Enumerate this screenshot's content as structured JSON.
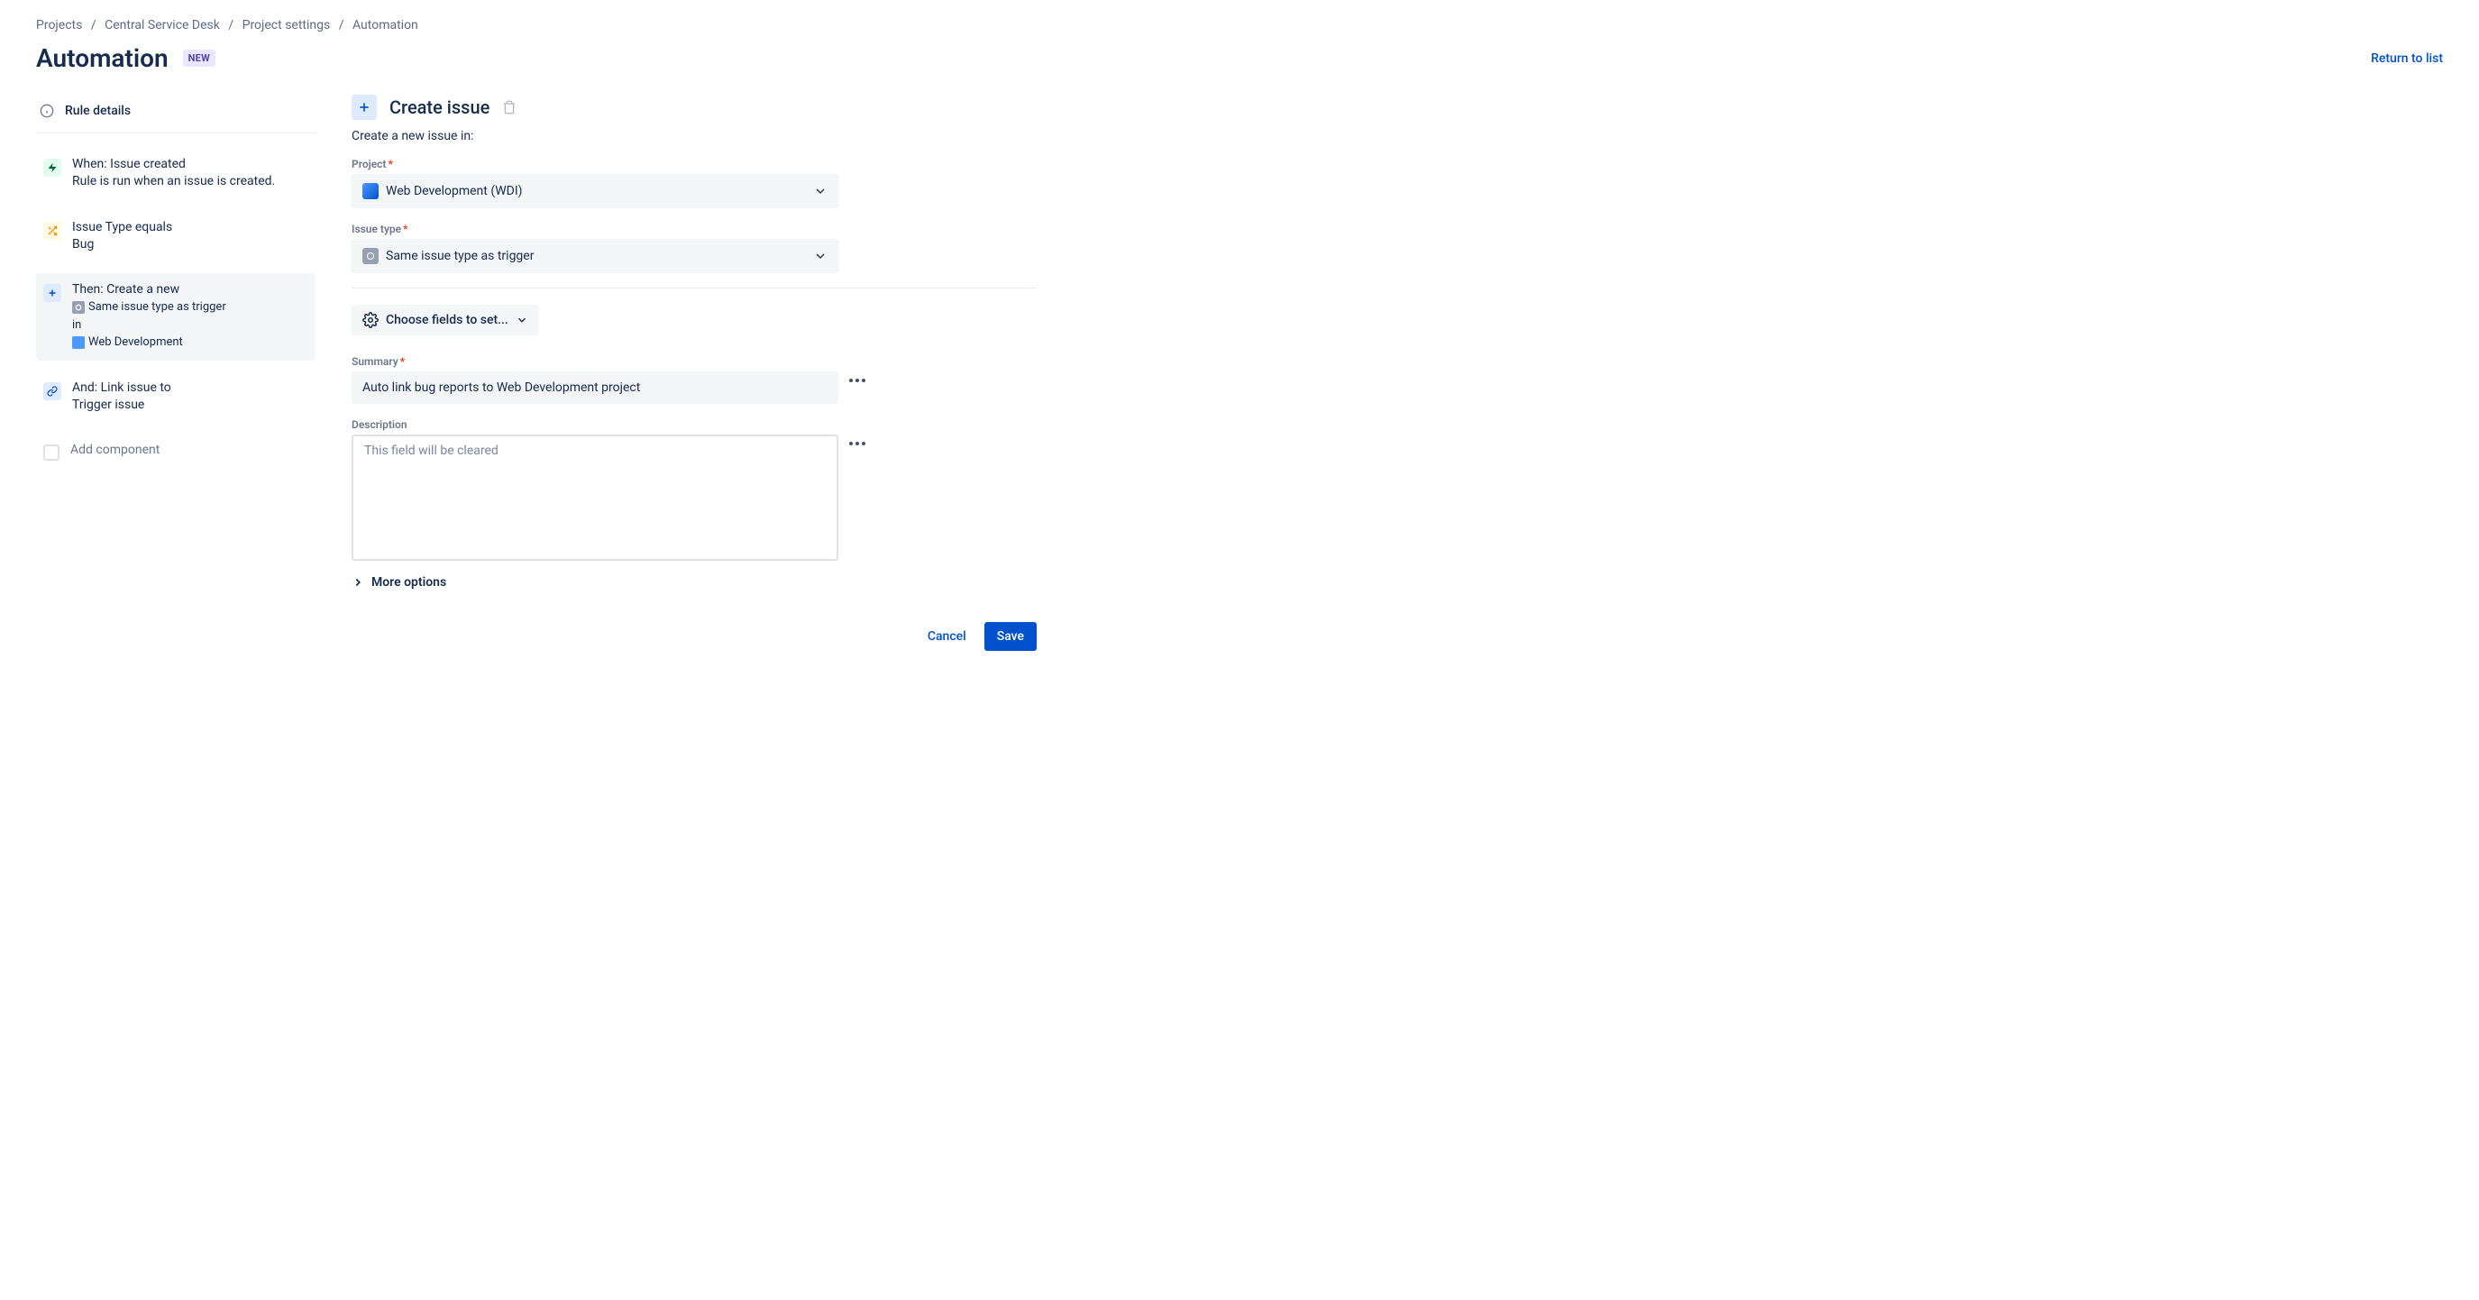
{
  "breadcrumb": {
    "items": [
      "Projects",
      "Central Service Desk",
      "Project settings",
      "Automation"
    ]
  },
  "header": {
    "title": "Automation",
    "badge": "NEW",
    "return_link": "Return to list"
  },
  "sidebar": {
    "rule_details_label": "Rule details",
    "steps": [
      {
        "title": "When: Issue created",
        "desc": "Rule is run when an issue is created."
      },
      {
        "title": "Issue Type equals",
        "desc": "Bug"
      },
      {
        "title": "Then: Create a new",
        "sub_same": "Same issue type as trigger",
        "sub_in": "in",
        "sub_proj": "Web Development"
      },
      {
        "title": "And: Link issue to",
        "desc": "Trigger issue"
      }
    ],
    "add_component": "Add component"
  },
  "panel": {
    "title": "Create issue",
    "subtitle": "Create a new issue in:",
    "project_label": "Project",
    "project_value": "Web Development (WDI)",
    "issue_type_label": "Issue type",
    "issue_type_value": "Same issue type as trigger",
    "choose_fields": "Choose fields to set...",
    "summary_label": "Summary",
    "summary_value": "Auto link bug reports to Web Development project",
    "description_label": "Description",
    "description_placeholder": "This field will be cleared",
    "more_options": "More options",
    "cancel": "Cancel",
    "save": "Save"
  }
}
